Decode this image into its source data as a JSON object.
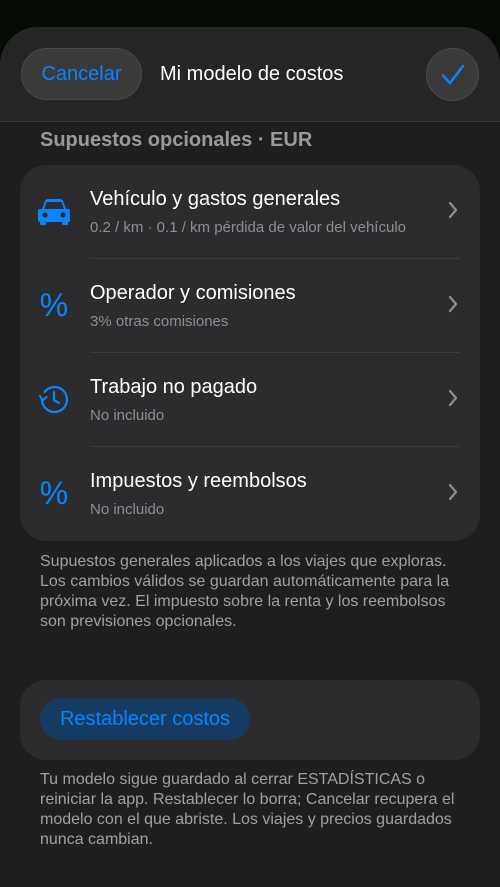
{
  "header": {
    "cancel_label": "Cancelar",
    "title": "Mi modelo de costos",
    "confirm_icon": "checkmark-icon"
  },
  "section": {
    "title": "Supuestos opcionales · EUR"
  },
  "rows": [
    {
      "icon": "car-icon",
      "label": "Vehículo y gastos generales",
      "sub": "0.2 / km · 0.1 / km pérdida de valor del vehículo"
    },
    {
      "icon": "percent-icon",
      "label": "Operador y comisiones",
      "sub": "3% otras comisiones"
    },
    {
      "icon": "clock-history-icon",
      "label": "Trabajo no pagado",
      "sub": "No incluido"
    },
    {
      "icon": "percent-icon",
      "label": "Impuestos y reembolsos",
      "sub": "No incluido"
    }
  ],
  "footnote_top": "Supuestos generales aplicados a los viajes que exploras. Los cambios válidos se guardan automáticamente para la próxima vez. El impuesto sobre la renta y los reembolsos son previsiones opcionales.",
  "reset": {
    "label": "Restablecer costos"
  },
  "footnote_bottom": "Tu modelo sigue guardado al cerrar ESTADÍSTICAS o reiniciar la app. Restablecer lo borra; Cancelar recupera el modelo con el que abriste. Los viajes y precios guardados nunca cambian.",
  "colors": {
    "accent": "#0a84ff",
    "background": "#1f1f1f",
    "card": "#2c2c2e"
  }
}
